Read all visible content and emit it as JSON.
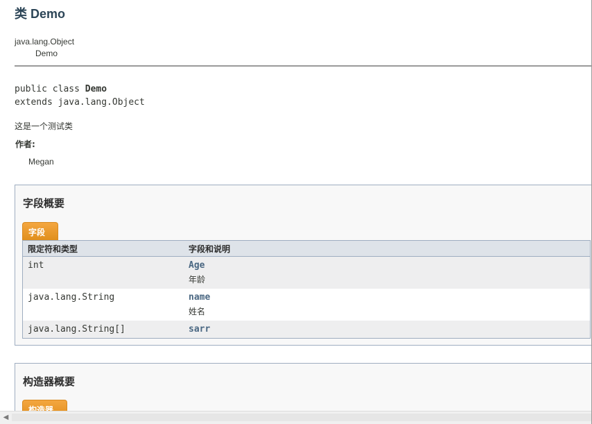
{
  "header": {
    "title": "类 Demo"
  },
  "inheritance": {
    "parent": "java.lang.Object",
    "child": "Demo"
  },
  "signature": {
    "prefix": "public class ",
    "class_name": "Demo",
    "extends_line": "extends java.lang.Object"
  },
  "description": "这是一个测试类",
  "author": {
    "label": "作者:",
    "name": "Megan"
  },
  "field_summary": {
    "heading": "字段概要",
    "tab": "字段",
    "columns": [
      "限定符和类型",
      "字段和说明"
    ],
    "rows": [
      {
        "type": "int",
        "name": "Age",
        "desc": "年龄"
      },
      {
        "type": "java.lang.String",
        "name": "name",
        "desc": "姓名"
      },
      {
        "type": "java.lang.String[]",
        "name": "sarr",
        "desc": ""
      }
    ]
  },
  "constructor_summary": {
    "heading": "构造器概要",
    "tab": "构造器"
  },
  "scrollbar": {
    "left_arrow": "◀"
  },
  "colors": {
    "link": "#4a6782",
    "tab": "#e08f1d",
    "table_header": "#dee3e9"
  }
}
